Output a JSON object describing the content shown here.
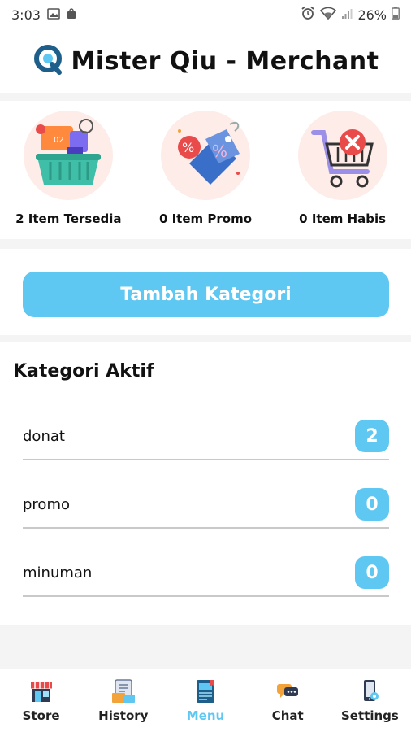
{
  "status_bar": {
    "time": "3:03",
    "battery": "26%"
  },
  "header": {
    "title": "Mister Qiu - Merchant"
  },
  "stats": [
    {
      "label": "2 Item Tersedia",
      "icon": "shopping-basket-icon"
    },
    {
      "label": "0 Item Promo",
      "icon": "discount-tag-icon"
    },
    {
      "label": "0 Item Habis",
      "icon": "empty-cart-icon"
    }
  ],
  "actions": {
    "add_category_label": "Tambah Kategori"
  },
  "categories": {
    "title": "Kategori Aktif",
    "items": [
      {
        "name": "donat",
        "count": "2"
      },
      {
        "name": "promo",
        "count": "0"
      },
      {
        "name": "minuman",
        "count": "0"
      }
    ]
  },
  "nav": {
    "items": [
      {
        "label": "Store",
        "icon": "store-icon"
      },
      {
        "label": "History",
        "icon": "history-icon"
      },
      {
        "label": "Menu",
        "icon": "menu-book-icon",
        "active": true
      },
      {
        "label": "Chat",
        "icon": "chat-icon"
      },
      {
        "label": "Settings",
        "icon": "settings-phone-icon"
      }
    ]
  },
  "colors": {
    "accent": "#5ec8f2",
    "brand": "#1d5f8a"
  }
}
